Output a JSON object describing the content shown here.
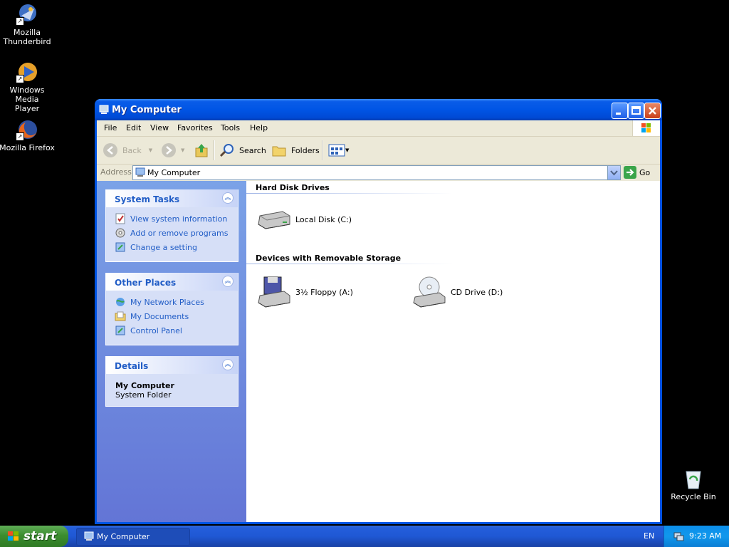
{
  "desktop": {
    "icons": [
      {
        "label": "Mozilla\nThunderbird",
        "icon": "thunderbird-icon"
      },
      {
        "label": "Windows Media\nPlayer",
        "icon": "media-player-icon"
      },
      {
        "label": "Mozilla Firefox",
        "icon": "firefox-icon"
      },
      {
        "label": "Recycle Bin",
        "icon": "recycle-bin-icon"
      }
    ]
  },
  "window": {
    "title": "My Computer",
    "menu": [
      "File",
      "Edit",
      "View",
      "Favorites",
      "Tools",
      "Help"
    ],
    "toolbar": {
      "back": "Back",
      "search": "Search",
      "folders": "Folders"
    },
    "address": {
      "label": "Address",
      "value": "My Computer",
      "go": "Go"
    },
    "panels": {
      "system_tasks": {
        "title": "System Tasks",
        "links": [
          "View system information",
          "Add or remove programs",
          "Change a setting"
        ]
      },
      "other_places": {
        "title": "Other Places",
        "links": [
          "My Network Places",
          "My Documents",
          "Control Panel"
        ]
      },
      "details": {
        "title": "Details",
        "name": "My Computer",
        "type": "System Folder"
      }
    },
    "groups": {
      "hard_disks": {
        "title": "Hard Disk Drives",
        "items": [
          "Local Disk (C:)"
        ]
      },
      "removable": {
        "title": "Devices with Removable Storage",
        "items": [
          "3½ Floppy (A:)",
          "CD Drive (D:)"
        ]
      }
    }
  },
  "taskbar": {
    "start": "start",
    "task": "My Computer",
    "language": "EN",
    "clock": "9:23 AM"
  },
  "colors": {
    "titlebar": "#0055e5",
    "link": "#215dc6",
    "leftpane": "#6f8fe0",
    "start": "#3c8d2f"
  }
}
